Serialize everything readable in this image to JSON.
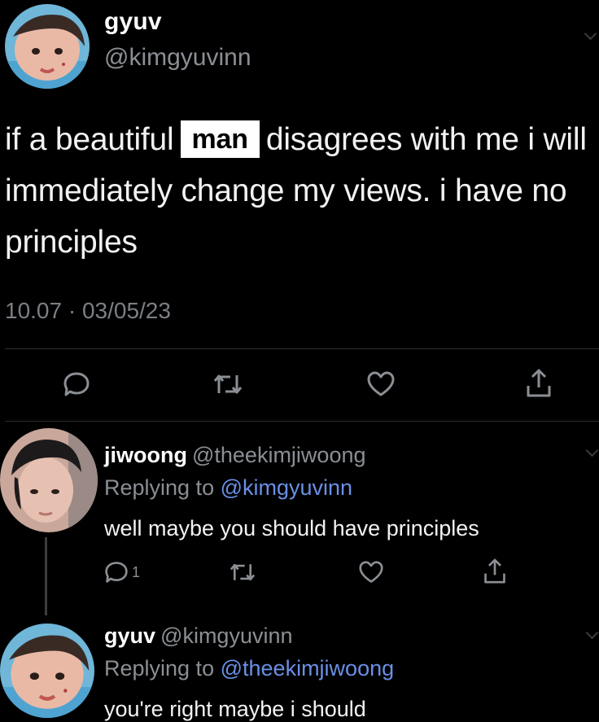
{
  "main_tweet": {
    "display_name": "gyuv",
    "handle": "@kimgyuvinn",
    "text_before": "if a beautiful",
    "boxed_word": "man",
    "text_after": "disagrees with me i will immediately change my views. i have no principles",
    "timestamp": "10.07 · 03/05/23",
    "actions": {
      "reply_icon": "comment-icon",
      "retweet_icon": "retweet-icon",
      "like_icon": "heart-icon",
      "share_icon": "share-icon"
    }
  },
  "replies": [
    {
      "display_name": "jiwoong",
      "handle": "@theekimjiwoong",
      "replying_prefix": "Replying to",
      "replying_to": "@kimgyuvinn",
      "text": "well maybe you should have principles",
      "reply_count": "1"
    },
    {
      "display_name": "gyuv",
      "handle": "@kimgyuvinn",
      "replying_prefix": "Replying to",
      "replying_to": "@theekimjiwoong",
      "text": "you're right maybe i should"
    }
  ],
  "colors": {
    "background": "#000000",
    "text": "#f2f2f2",
    "secondary": "#8b8f94",
    "mention": "#6a8fe6",
    "divider": "#2a2d30"
  }
}
